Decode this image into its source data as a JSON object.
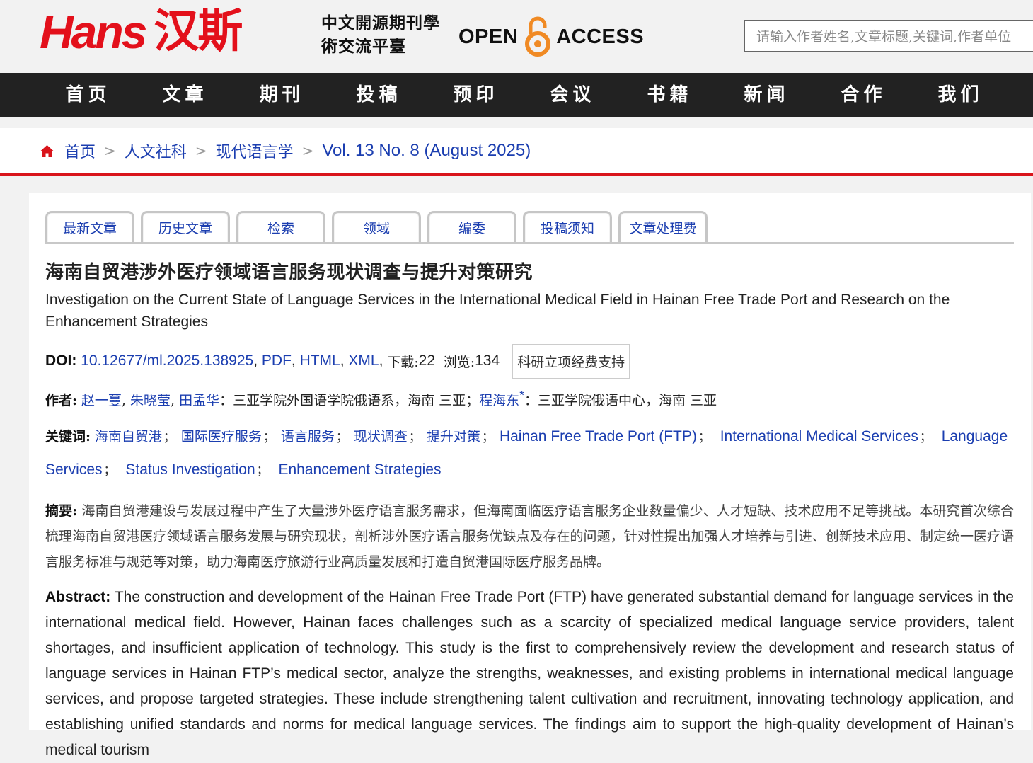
{
  "header": {
    "logo_latin": "Hans",
    "logo_cn": "汉斯",
    "logo_sub": "中文開源期刊學術交流平臺",
    "oa_left": "OPEN",
    "oa_right": "ACCESS",
    "search_placeholder": "请输入作者姓名,文章标题,关键词,作者单位"
  },
  "nav": [
    "首页",
    "文章",
    "期刊",
    "投稿",
    "预印",
    "会议",
    "书籍",
    "新闻",
    "合作",
    "我们"
  ],
  "breadcrumb": [
    "首页",
    "人文社科",
    "现代语言学",
    "Vol. 13 No. 8 (August 2025)"
  ],
  "tabs": [
    "最新文章",
    "历史文章",
    "检索",
    "领域",
    "编委",
    "投稿须知",
    "文章处理费"
  ],
  "article": {
    "title_cn": "海南自贸港涉外医疗领域语言服务现状调查与提升对策研究",
    "title_en": "Investigation on the Current State of Language Services in the International Medical Field in Hainan Free Trade Port and Research on the Enhancement Strategies",
    "doi_label": "DOI:",
    "doi": "10.12677/ml.2025.138925",
    "formats": [
      "PDF",
      "HTML",
      "XML"
    ],
    "downloads_label": "下载:",
    "downloads": "22",
    "views_label": "浏览:",
    "views": "134",
    "fund_label": "科研立项经费支持",
    "authors_label": "作者:",
    "authors_group1": [
      "赵一蔓",
      "朱晓莹",
      "田孟华"
    ],
    "affil1": "三亚学院外国语学院俄语系，海南 三亚",
    "author_corr": "程海东",
    "affil2": "三亚学院俄语中心，海南 三亚",
    "keywords_label": "关键词:",
    "keywords_cn": [
      "海南自贸港",
      "国际医疗服务",
      "语言服务",
      "现状调查",
      "提升对策"
    ],
    "keywords_en": [
      "Hainan Free Trade Port (FTP)",
      "International Medical Services",
      "Language Services",
      "Status Investigation",
      "Enhancement Strategies"
    ],
    "abstract_cn_label": "摘要:",
    "abstract_cn": "海南自贸港建设与发展过程中产生了大量涉外医疗语言服务需求，但海南面临医疗语言服务企业数量偏少、人才短缺、技术应用不足等挑战。本研究首次综合梳理海南自贸港医疗领域语言服务发展与研究现状，剖析涉外医疗语言服务优缺点及存在的问题，针对性提出加强人才培养与引进、创新技术应用、制定统一医疗语言服务标准与规范等对策，助力海南医疗旅游行业高质量发展和打造自贸港国际医疗服务品牌。",
    "abstract_en_label": "Abstract:",
    "abstract_en": "The construction and development of the Hainan Free Trade Port (FTP) have generated substantial demand for language services in the international medical field. However, Hainan faces challenges such as a scarcity of specialized medical language service providers, talent shortages, and insufficient application of technology. This study is the first to comprehensively review the development and research status of language services in Hainan FTP’s medical sector, analyze the strengths, weaknesses, and existing problems in international medical language services, and propose targeted strategies. These include strengthening talent cultivation and recruitment, innovating technology application, and establishing unified standards and norms for medical language services. The findings aim to support the high-quality development of Hainan’s medical tourism"
  },
  "colors": {
    "brand_red": "#e3101b",
    "link_blue": "#1b3eb0",
    "nav_bg": "#222222",
    "oa_orange": "#f08a24"
  }
}
